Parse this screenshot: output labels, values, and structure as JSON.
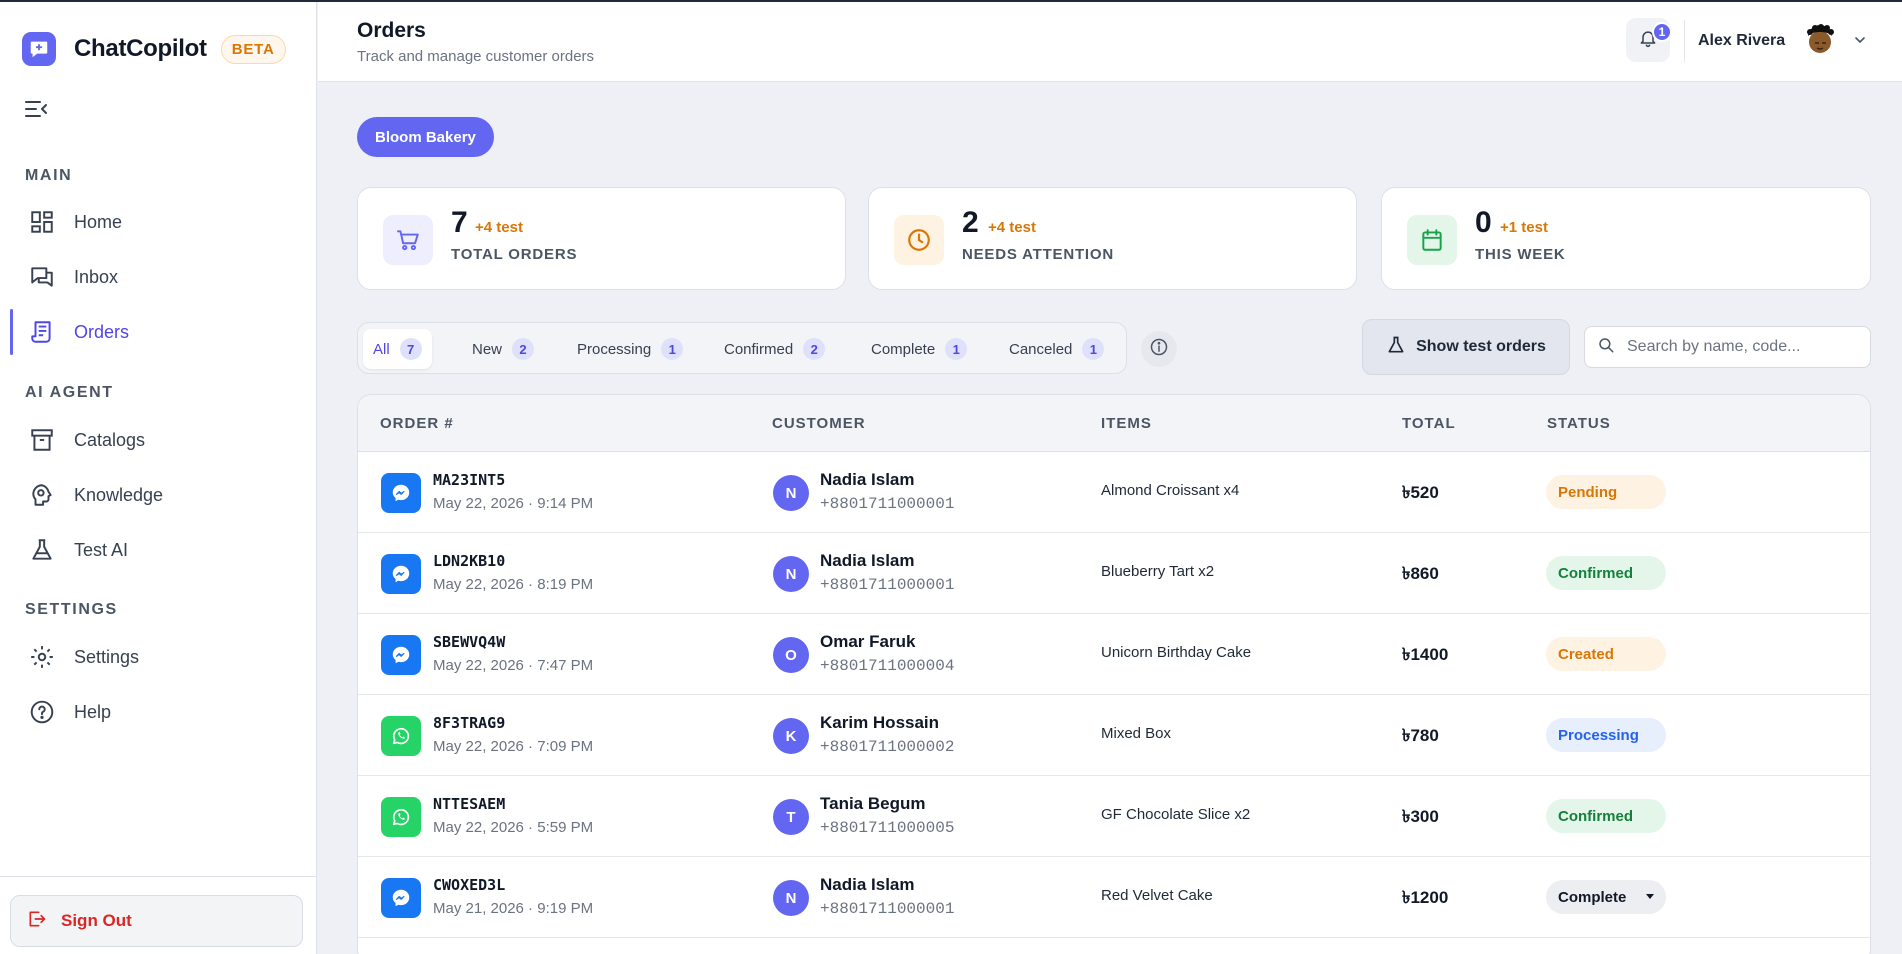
{
  "brand": {
    "name": "ChatCopilot",
    "badge": "BETA"
  },
  "sidebar": {
    "sections": [
      {
        "label": "MAIN"
      },
      {
        "label": "AI AGENT"
      },
      {
        "label": "SETTINGS"
      }
    ],
    "items": [
      {
        "label": "Home",
        "icon": "dashboard-icon"
      },
      {
        "label": "Inbox",
        "icon": "chat-icon"
      },
      {
        "label": "Orders",
        "icon": "receipt-icon",
        "active": true
      },
      {
        "label": "Catalogs",
        "icon": "archive-icon"
      },
      {
        "label": "Knowledge",
        "icon": "brain-icon"
      },
      {
        "label": "Test AI",
        "icon": "flask-icon"
      },
      {
        "label": "Settings",
        "icon": "gear-icon"
      },
      {
        "label": "Help",
        "icon": "help-icon"
      }
    ],
    "signout": "Sign Out"
  },
  "header": {
    "title": "Orders",
    "subtitle": "Track and manage customer orders",
    "notification_count": "1",
    "user_name": "Alex Rivera"
  },
  "store": {
    "name": "Bloom Bakery"
  },
  "stats": [
    {
      "value": "7",
      "test": "+4 test",
      "label": "TOTAL ORDERS",
      "icon": "cart-icon"
    },
    {
      "value": "2",
      "test": "+4 test",
      "label": "NEEDS ATTENTION",
      "icon": "clock-icon"
    },
    {
      "value": "0",
      "test": "+1 test",
      "label": "THIS WEEK",
      "icon": "calendar-icon"
    }
  ],
  "tabs": [
    {
      "label": "All",
      "count": "7",
      "active": true
    },
    {
      "label": "New",
      "count": "2"
    },
    {
      "label": "Processing",
      "count": "1"
    },
    {
      "label": "Confirmed",
      "count": "2"
    },
    {
      "label": "Complete",
      "count": "1"
    },
    {
      "label": "Canceled",
      "count": "1"
    }
  ],
  "toolbar": {
    "test_orders_label": "Show test orders",
    "search_placeholder": "Search by name, code..."
  },
  "table": {
    "columns": [
      "ORDER #",
      "CUSTOMER",
      "ITEMS",
      "TOTAL",
      "STATUS"
    ],
    "rows": [
      {
        "channel": "messenger",
        "code": "MA23INT5",
        "date": "May 22, 2026 · 9:14 PM",
        "initial": "N",
        "customer": "Nadia Islam",
        "phone": "+8801711000001",
        "items": "Almond Croissant x4",
        "total": "৳520",
        "status": "Pending"
      },
      {
        "channel": "messenger",
        "code": "LDN2KB10",
        "date": "May 22, 2026 · 8:19 PM",
        "initial": "N",
        "customer": "Nadia Islam",
        "phone": "+8801711000001",
        "items": "Blueberry Tart x2",
        "total": "৳860",
        "status": "Confirmed"
      },
      {
        "channel": "messenger",
        "code": "SBEWVQ4W",
        "date": "May 22, 2026 · 7:47 PM",
        "initial": "O",
        "customer": "Omar Faruk",
        "phone": "+8801711000004",
        "items": "Unicorn Birthday Cake",
        "total": "৳1400",
        "status": "Created"
      },
      {
        "channel": "whatsapp",
        "code": "8F3TRAG9",
        "date": "May 22, 2026 · 7:09 PM",
        "initial": "K",
        "customer": "Karim Hossain",
        "phone": "+8801711000002",
        "items": "Mixed Box",
        "total": "৳780",
        "status": "Processing"
      },
      {
        "channel": "whatsapp",
        "code": "NTTESAEM",
        "date": "May 22, 2026 · 5:59 PM",
        "initial": "T",
        "customer": "Tania Begum",
        "phone": "+8801711000005",
        "items": "GF Chocolate Slice x2",
        "total": "৳300",
        "status": "Confirmed"
      },
      {
        "channel": "messenger",
        "code": "CWOXED3L",
        "date": "May 21, 2026 · 9:19 PM",
        "initial": "N",
        "customer": "Nadia Islam",
        "phone": "+8801711000001",
        "items": "Red Velvet Cake",
        "total": "৳1200",
        "status": "Complete"
      }
    ]
  },
  "colors": {
    "accent": "#6366f1",
    "messenger": "#1877f2",
    "whatsapp": "#25d366",
    "danger": "#dc2626",
    "warning": "#d97706",
    "success": "#15803d"
  }
}
